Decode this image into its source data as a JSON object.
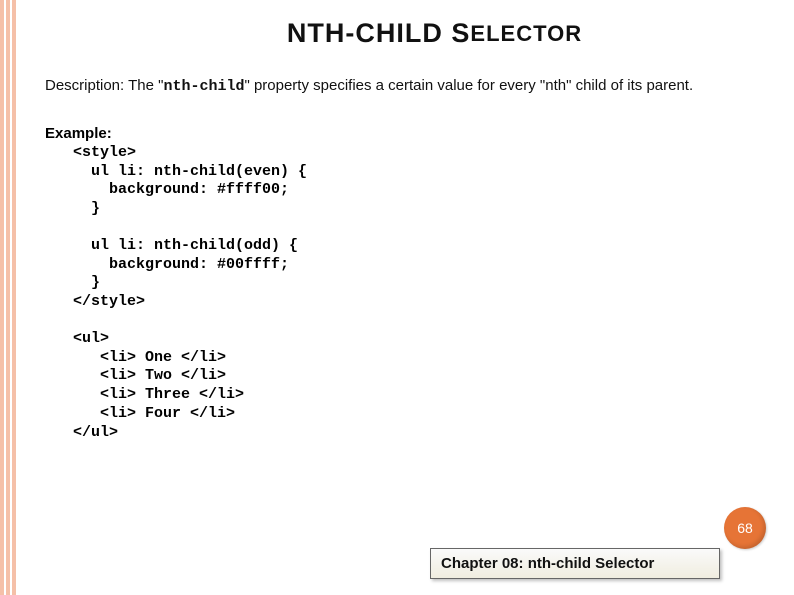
{
  "title": {
    "part1": "NTH",
    "hyphen": "-",
    "part2": "CHILD",
    "space": " ",
    "s": "S",
    "part3": "ELECTOR"
  },
  "description": {
    "prefix": "Description: The  \"",
    "code": "nth-child",
    "suffix": "\"  property specifies a certain value for every \"nth\" child of its parent."
  },
  "example_label": "Example:",
  "code": {
    "block1": "<style>\n  ul li: nth-child(even) {\n    background: #ffff00;\n  }",
    "block2": "  ul li: nth-child(odd) {\n    background: #00ffff;\n  }\n</style>",
    "block3": "<ul>\n   <li> One </li>\n   <li> Two </li>\n   <li> Three </li>\n   <li> Four </li>\n</ul>"
  },
  "page_number": "68",
  "chapter": "Chapter  08: nth-child Selector"
}
